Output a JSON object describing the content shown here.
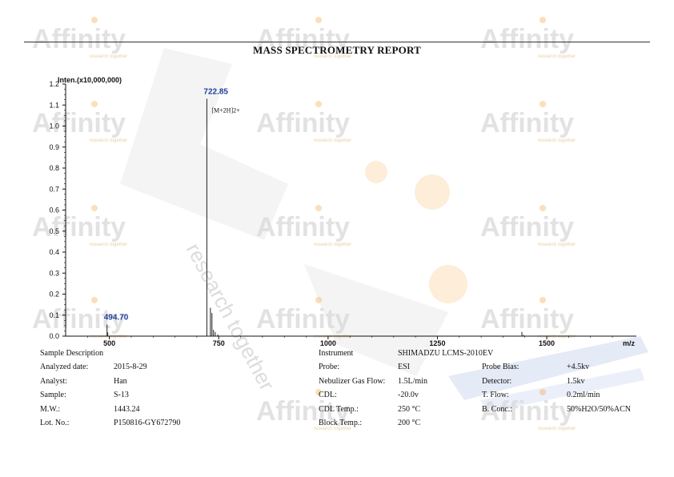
{
  "report": {
    "title": "MASS SPECTROMETRY REPORT",
    "watermark_brand": "Affinity",
    "watermark_tagline": "research together",
    "brand_color": "#f2a23a",
    "watermark_color": "#d9d9d9"
  },
  "chart_data": {
    "type": "bar",
    "ylabel": "Inten.(x10,000,000)",
    "xlabel": "m/z",
    "xlim": [
      400,
      1650
    ],
    "ylim": [
      0.0,
      1.2
    ],
    "x_ticks": [
      500,
      750,
      1000,
      1250,
      1500
    ],
    "y_ticks": [
      "0.0",
      "0.1",
      "0.2",
      "0.3",
      "0.4",
      "0.5",
      "0.6",
      "0.7",
      "0.8",
      "0.9",
      "1.0",
      "1.1",
      "1.2"
    ],
    "peaks": [
      {
        "x": 494.7,
        "y": 0.055
      },
      {
        "x": 496.3,
        "y": 0.018
      },
      {
        "x": 722.85,
        "y": 1.13
      },
      {
        "x": 731.0,
        "y": 0.135
      },
      {
        "x": 734.5,
        "y": 0.11
      },
      {
        "x": 738.0,
        "y": 0.03
      },
      {
        "x": 742.0,
        "y": 0.02
      },
      {
        "x": 748.0,
        "y": 0.008
      },
      {
        "x": 1443.2,
        "y": 0.02
      },
      {
        "x": 1447.0,
        "y": 0.006
      }
    ],
    "peak_labels": [
      {
        "x": 722.85,
        "y": 1.13,
        "text": "722.85"
      },
      {
        "x": 494.7,
        "y": 0.055,
        "text": "494.70"
      }
    ],
    "annotation": {
      "text": "[M+2H]2+",
      "x": 722.85
    }
  },
  "sample": {
    "heading": "Sample Description",
    "rows": [
      {
        "label": "Analyzed date:",
        "value": "2015-8-29"
      },
      {
        "label": "Analyst:",
        "value": "Han"
      },
      {
        "label": "Sample:",
        "value": "S-13"
      },
      {
        "label": "M.W.:",
        "value": "1443.24"
      },
      {
        "label": "Lot. No.:",
        "value": "P150816-GY672790"
      }
    ]
  },
  "instrument": {
    "label": "Instrument",
    "value": "SHIMADZU LCMS-2010EV",
    "rows": [
      {
        "label": "Probe:",
        "value": "ESI",
        "label2": "Probe Bias:",
        "value2": "+4.5kv"
      },
      {
        "label": "Nebulizer Gas Flow:",
        "value": "1.5L/min",
        "label2": "Detector:",
        "value2": "1.5kv"
      },
      {
        "label": "CDL:",
        "value": "-20.0v",
        "label2": "T. Flow:",
        "value2": "0.2ml/min"
      },
      {
        "label": "CDL Temp.:",
        "value": "250 °C",
        "label2": "B. Conc.:",
        "value2": "50%H2O/50%ACN"
      },
      {
        "label": "Block Temp.:",
        "value": "200 °C"
      }
    ]
  }
}
